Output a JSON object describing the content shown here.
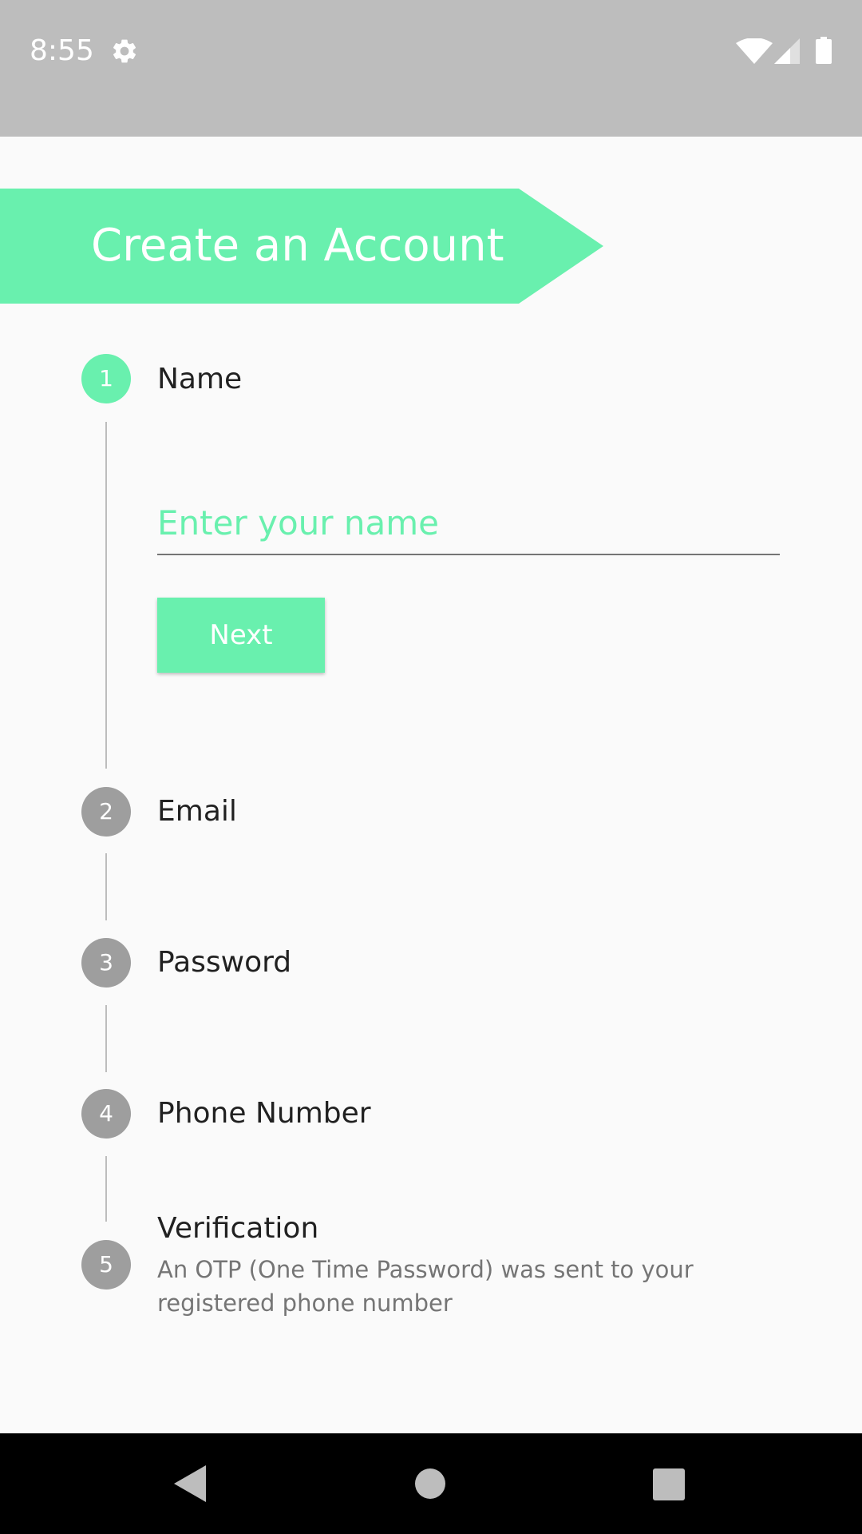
{
  "status_bar": {
    "time": "8:55",
    "icons": [
      "gear-icon",
      "wifi-icon",
      "signal-icon",
      "battery-icon"
    ]
  },
  "header": {
    "title": "Create an Account",
    "color": "#69f0ae"
  },
  "stepper": {
    "steps": [
      {
        "number": "1",
        "title": "Name",
        "state": "active"
      },
      {
        "number": "2",
        "title": "Email",
        "state": "inactive"
      },
      {
        "number": "3",
        "title": "Password",
        "state": "inactive"
      },
      {
        "number": "4",
        "title": "Phone Number",
        "state": "inactive"
      },
      {
        "number": "5",
        "title": "Verification",
        "subtitle": "An OTP (One Time Password) was sent to your registered phone number",
        "state": "inactive"
      }
    ],
    "name_input": {
      "value": "",
      "placeholder": "Enter your name"
    },
    "next_label": "Next"
  },
  "colors": {
    "accent": "#69f0ae",
    "inactive": "#9e9e9e",
    "status_bar": "#bdbdbd",
    "background": "#fafafa"
  },
  "nav_bar": {
    "buttons": [
      "back-icon",
      "home-icon",
      "recent-apps-icon"
    ]
  }
}
